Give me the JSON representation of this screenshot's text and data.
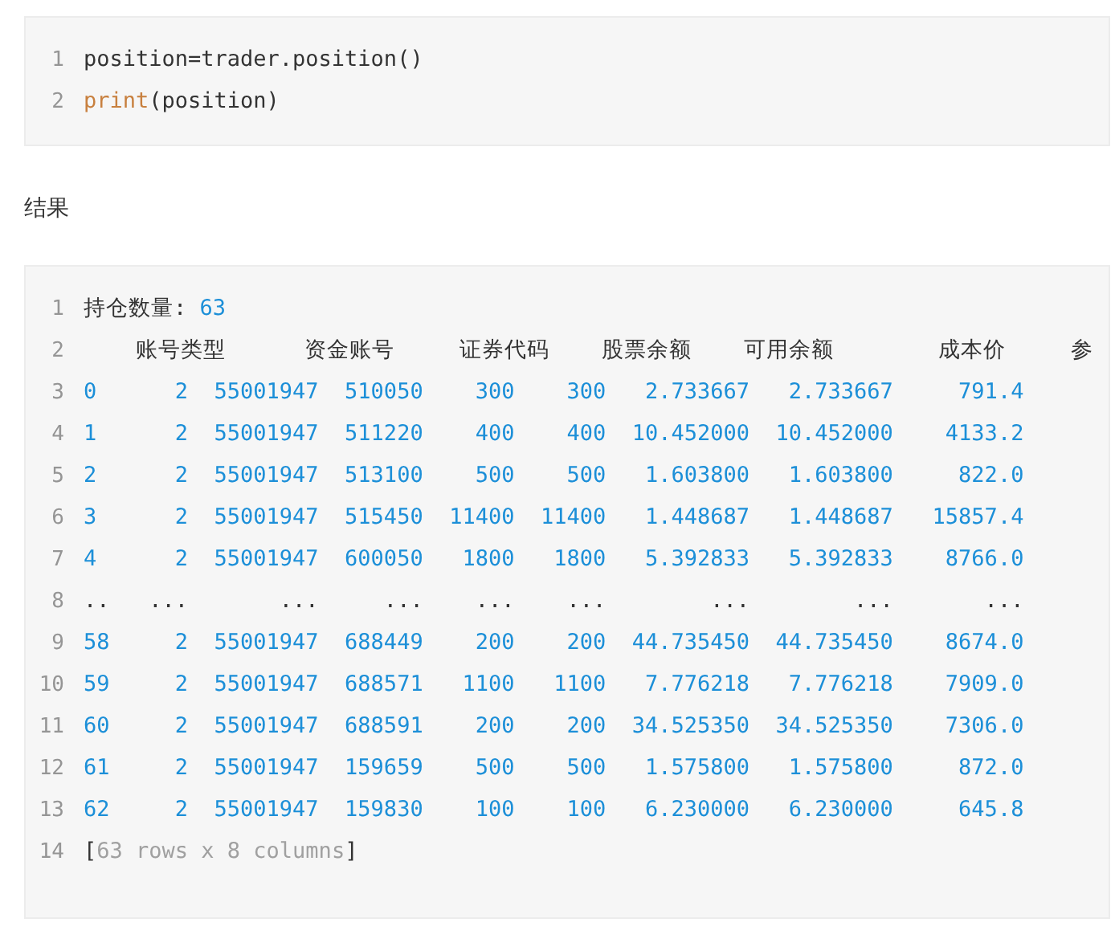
{
  "blocks": [
    {
      "kind": "code",
      "lines": [
        {
          "number": "1",
          "tokens": [
            {
              "text": "position=trader.position()",
              "kind": "plain"
            }
          ]
        },
        {
          "number": "2",
          "tokens": [
            {
              "text": "print",
              "kind": "keyword"
            },
            {
              "text": "(position)",
              "kind": "plain"
            }
          ]
        }
      ]
    },
    {
      "kind": "heading",
      "text": "结果"
    },
    {
      "kind": "code",
      "lines": [
        {
          "number": "1",
          "tokens": [
            {
              "text": "持仓数量: ",
              "kind": "plain"
            },
            {
              "text": "63",
              "kind": "number"
            }
          ]
        },
        {
          "number": "2",
          "tokens": [
            {
              "text": "    账号类型      资金账号     证券代码    股票余额    可用余额        成本价     参",
              "kind": "plain"
            }
          ]
        },
        {
          "number": "3",
          "tokens": [
            {
              "text": "0      2  55001947  510050    300    300   2.733667   2.733667     791.4",
              "kind": "number"
            }
          ]
        },
        {
          "number": "4",
          "tokens": [
            {
              "text": "1      2  55001947  511220    400    400  10.452000  10.452000    4133.2",
              "kind": "number"
            }
          ]
        },
        {
          "number": "5",
          "tokens": [
            {
              "text": "2      2  55001947  513100    500    500   1.603800   1.603800     822.0",
              "kind": "number"
            }
          ]
        },
        {
          "number": "6",
          "tokens": [
            {
              "text": "3      2  55001947  515450  11400  11400   1.448687   1.448687   15857.4",
              "kind": "number"
            }
          ]
        },
        {
          "number": "7",
          "tokens": [
            {
              "text": "4      2  55001947  600050   1800   1800   5.392833   5.392833    8766.0",
              "kind": "number"
            }
          ]
        },
        {
          "number": "8",
          "tokens": [
            {
              "text": "..   ...       ...     ...    ...    ...        ...        ...       ...",
              "kind": "plain"
            }
          ]
        },
        {
          "number": "9",
          "tokens": [
            {
              "text": "58     2  55001947  688449    200    200  44.735450  44.735450    8674.0",
              "kind": "number"
            }
          ]
        },
        {
          "number": "10",
          "tokens": [
            {
              "text": "59     2  55001947  688571   1100   1100   7.776218   7.776218    7909.0",
              "kind": "number"
            }
          ]
        },
        {
          "number": "11",
          "tokens": [
            {
              "text": "60     2  55001947  688591    200    200  34.525350  34.525350    7306.0",
              "kind": "number"
            }
          ]
        },
        {
          "number": "12",
          "tokens": [
            {
              "text": "61     2  55001947  159659    500    500   1.575800   1.575800     872.0",
              "kind": "number"
            }
          ]
        },
        {
          "number": "13",
          "tokens": [
            {
              "text": "62     2  55001947  159830    100    100   6.230000   6.230000     645.8",
              "kind": "number"
            }
          ]
        },
        {
          "number": "14",
          "tokens": [
            {
              "text": "[",
              "kind": "plain"
            },
            {
              "text": "63 rows x 8 columns",
              "kind": "comment"
            },
            {
              "text": "]",
              "kind": "plain"
            }
          ]
        }
      ]
    }
  ]
}
